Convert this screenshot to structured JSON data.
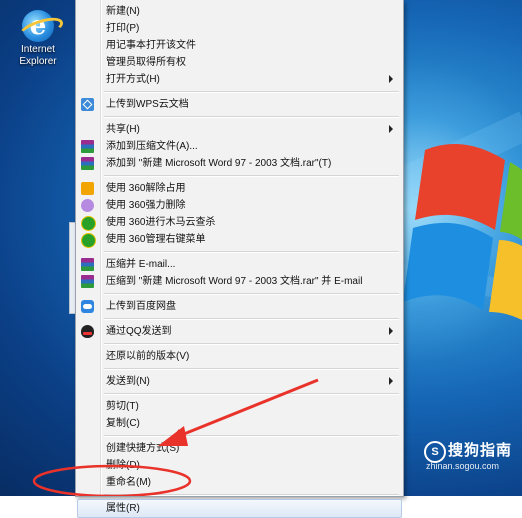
{
  "desktop": {
    "icons": [
      {
        "line1": "Internet",
        "line2": "Explorer",
        "icon": "internet-explorer-icon"
      }
    ]
  },
  "menu": {
    "groups": [
      [
        {
          "label": "新建(N)"
        },
        {
          "label": "打印(P)"
        },
        {
          "label": "用记事本打开该文件"
        },
        {
          "label": "管理员取得所有权"
        },
        {
          "label": "打开方式(H)",
          "submenu": true
        }
      ],
      [
        {
          "label": "上传到WPS云文档",
          "icon": "wps-cloud-icon"
        }
      ],
      [
        {
          "label": "共享(H)",
          "submenu": true
        },
        {
          "label": "添加到压缩文件(A)...",
          "icon": "winrar-icon"
        },
        {
          "label": "添加到 \"新建 Microsoft Word 97 - 2003 文档.rar\"(T)",
          "icon": "winrar-icon"
        }
      ],
      [
        {
          "label": "使用 360解除占用",
          "icon": "360-unlock-icon"
        },
        {
          "label": "使用 360强力删除",
          "icon": "360-delete-icon"
        },
        {
          "label": "使用 360进行木马云查杀",
          "icon": "360-scan-icon"
        },
        {
          "label": "使用 360管理右键菜单",
          "icon": "360-manage-icon"
        }
      ],
      [
        {
          "label": "压缩并 E-mail...",
          "icon": "winrar-icon"
        },
        {
          "label": "压缩到 \"新建 Microsoft Word 97 - 2003 文档.rar\" 并 E-mail",
          "icon": "winrar-icon"
        }
      ],
      [
        {
          "label": "上传到百度网盘",
          "icon": "baidu-cloud-icon"
        }
      ],
      [
        {
          "label": "通过QQ发送到",
          "icon": "qq-icon",
          "submenu": true
        }
      ],
      [
        {
          "label": "还原以前的版本(V)"
        }
      ],
      [
        {
          "label": "发送到(N)",
          "submenu": true
        }
      ],
      [
        {
          "label": "剪切(T)"
        },
        {
          "label": "复制(C)"
        }
      ],
      [
        {
          "label": "创建快捷方式(S)"
        },
        {
          "label": "删除(D)"
        },
        {
          "label": "重命名(M)"
        }
      ],
      [
        {
          "label": "属性(R)",
          "highlight": true
        }
      ]
    ]
  },
  "annotation": {
    "color": "#e8322a"
  },
  "watermark": {
    "brand": "搜狗指南",
    "url": "zhinan.sogou.com"
  }
}
